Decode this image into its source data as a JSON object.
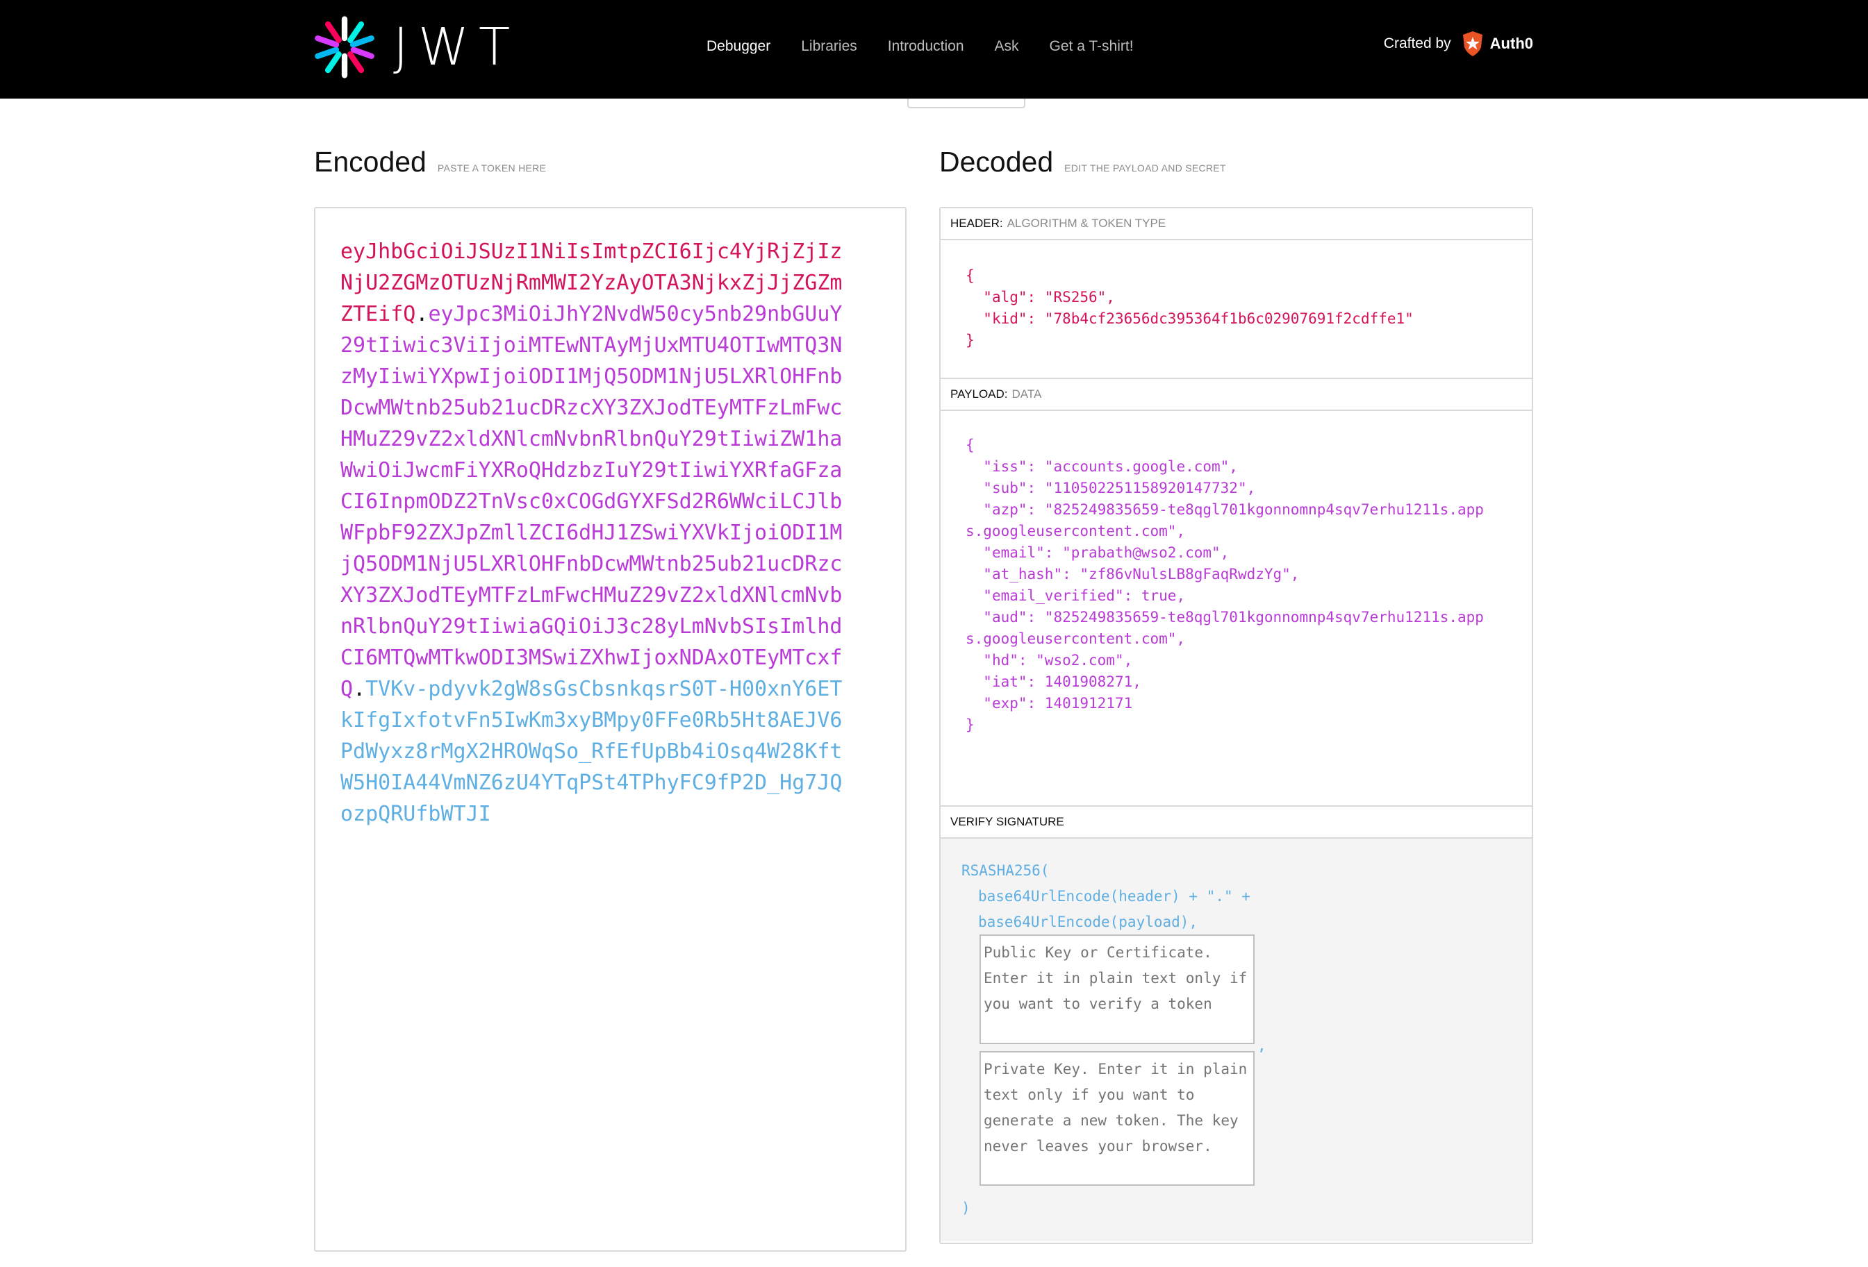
{
  "nav": {
    "logo_text": "JWT",
    "items": [
      "Debugger",
      "Libraries",
      "Introduction",
      "Ask",
      "Get a T-shirt!"
    ],
    "crafted_label": "Crafted by",
    "brand_name": "Auth0"
  },
  "encoded": {
    "title": "Encoded",
    "subtitle": "PASTE A TOKEN HERE",
    "token_header": "eyJhbGciOiJSUzI1NiIsImtpZCI6Ijc4YjRjZjIzNjU2ZGMzOTUzNjRmMWI2YzAyOTA3NjkxZjJjZGZmZTEifQ",
    "token_payload": "eyJpc3MiOiJhY2NvdW50cy5nb29nbGUuY29tIiwic3ViIjoiMTEwNTAyMjUxMTU4OTIwMTQ3NzMyIiwiYXpwIjoiODI1MjQ5ODM1NjU5LXRlOHFnbDcwMWtnb25ub21ucDRzcXY3ZXJodTEyMTFzLmFwcHMuZ29vZ2xldXNlcmNvbnRlbnQuY29tIiwiZW1haWwiOiJwcmFiYXRoQHdzbzIuY29tIiwiYXRfaGFzaCI6InpmODZ2TnVsc0xCOGdGYXFSd2R6WWciLCJlbWFpbF92ZXJpZmllZCI6dHJ1ZSwiYXVkIjoiODI1MjQ5ODM1NjU5LXRlOHFnbDcwMWtnb25ub21ucDRzcXY3ZXJodTEyMTFzLmFwcHMuZ29vZ2xldXNlcmNvbnRlbnQuY29tIiwiaGQiOiJ3c28yLmNvbSIsImlhdCI6MTQwMTkwODI3MSwiZXhwIjoxNDAxOTEyMTcxfQ",
    "token_signature": "TVKv-pdyvk2gW8sGsCbsnkqsrS0T-H00xnY6ETkIfgIxfotvFn5IwKm3xyBMpy0FFe0Rb5Ht8AEJV6PdWyxz8rMgX2HROWqSo_RfEfUpBb4iOsq4W28KftW5H0IA44VmNZ6zU4YTqPSt4TPhyFC9fP2D_Hg7JQozpQRUfbWTJI",
    "dot": "."
  },
  "decoded": {
    "title": "Decoded",
    "subtitle": "EDIT THE PAYLOAD AND SECRET",
    "header_label": "HEADER:",
    "header_sub": "ALGORITHM & TOKEN TYPE",
    "header_json": "{\n  \"alg\": \"RS256\",\n  \"kid\": \"78b4cf23656dc395364f1b6c02907691f2cdffe1\"\n}",
    "payload_label": "PAYLOAD:",
    "payload_sub": "DATA",
    "payload_json": "{\n  \"iss\": \"accounts.google.com\",\n  \"sub\": \"110502251158920147732\",\n  \"azp\": \"825249835659-te8qgl701kgonnomnp4sqv7erhu1211s.apps.googleusercontent.com\",\n  \"email\": \"prabath@wso2.com\",\n  \"at_hash\": \"zf86vNulsLB8gFaqRwdzYg\",\n  \"email_verified\": true,\n  \"aud\": \"825249835659-te8qgl701kgonnomnp4sqv7erhu1211s.apps.googleusercontent.com\",\n  \"hd\": \"wso2.com\",\n  \"iat\": 1401908271,\n  \"exp\": 1401912171\n}",
    "verify_label": "VERIFY SIGNATURE",
    "sig_fn": "RSASHA256(",
    "sig_line1": "base64UrlEncode(header) + \".\" +",
    "sig_line2": "base64UrlEncode(payload),",
    "public_key_placeholder": "Public Key or Certificate. Enter it in plain text only if you want to verify a token",
    "private_key_placeholder": "Private Key. Enter it in plain text only if you want to generate a new token. The key never leaves your browser.",
    "comma": ",",
    "close_paren": ")"
  },
  "colors": {
    "header": "#d4145a",
    "payload": "#b93ad6",
    "signature": "#5fafe3"
  }
}
